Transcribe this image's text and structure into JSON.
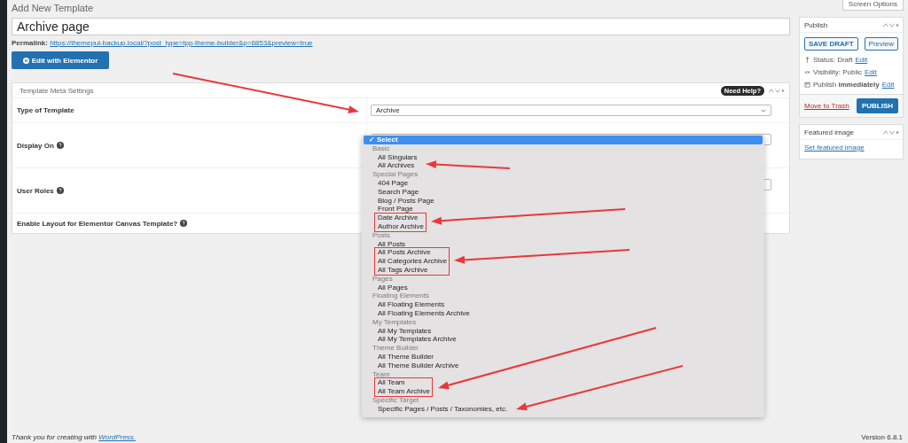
{
  "page": {
    "title": "Add New Template",
    "screen_options": "Screen Options"
  },
  "post_title": {
    "value": "Archive page"
  },
  "permalink": {
    "label": "Permalink:",
    "url": "https://themepul-backup.local/?post_type=tpp-theme-builder&p=6853&preview=true"
  },
  "elementor_button": "Edit with Elementor",
  "meta_box": {
    "title": "Template Meta Settings",
    "help_badge": "Need Help?",
    "fields": [
      {
        "label": "Type of Template",
        "help": false,
        "kind": "select",
        "value": "Archive"
      },
      {
        "label": "Display On",
        "help": true,
        "kind": "rule"
      },
      {
        "label": "User Roles",
        "help": true,
        "kind": "rule"
      },
      {
        "label": "Enable Layout for Elementor Canvas Template?",
        "help": true,
        "kind": "plain"
      }
    ]
  },
  "dropdown": {
    "first_option": {
      "label": "Select",
      "selected": true,
      "check": "✓"
    },
    "groups": [
      {
        "label": "Basic",
        "options": [
          {
            "label": "All Singulars",
            "selected": false,
            "highlighted": false
          },
          {
            "label": "All Archives",
            "selected": false,
            "highlighted": false
          }
        ]
      },
      {
        "label": "Special Pages",
        "options": [
          {
            "label": "404 Page",
            "selected": false,
            "highlighted": false
          },
          {
            "label": "Search Page",
            "selected": false,
            "highlighted": false
          },
          {
            "label": "Blog / Posts Page",
            "selected": false,
            "highlighted": false
          },
          {
            "label": "Front Page",
            "selected": false,
            "highlighted": false
          },
          {
            "label": "Date Archive",
            "selected": false,
            "highlighted": true
          },
          {
            "label": "Author Archive",
            "selected": false,
            "highlighted": true
          }
        ]
      },
      {
        "label": "Posts",
        "options": [
          {
            "label": "All Posts",
            "selected": false,
            "highlighted": false
          },
          {
            "label": "All Posts Archive",
            "selected": false,
            "highlighted": true
          },
          {
            "label": "All Categories Archive",
            "selected": false,
            "highlighted": true
          },
          {
            "label": "All Tags Archive",
            "selected": false,
            "highlighted": true
          }
        ]
      },
      {
        "label": "Pages",
        "options": [
          {
            "label": "All Pages",
            "selected": false,
            "highlighted": false
          }
        ]
      },
      {
        "label": "Floating Elements",
        "options": [
          {
            "label": "All Floating Elements",
            "selected": false,
            "highlighted": false
          },
          {
            "label": "All Floating Elements Archive",
            "selected": false,
            "highlighted": false
          }
        ]
      },
      {
        "label": "My Templates",
        "options": [
          {
            "label": "All My Templates",
            "selected": false,
            "highlighted": false
          },
          {
            "label": "All My Templates Archive",
            "selected": false,
            "highlighted": false
          }
        ]
      },
      {
        "label": "Theme Builder",
        "options": [
          {
            "label": "All Theme Builder",
            "selected": false,
            "highlighted": false
          },
          {
            "label": "All Theme Builder Archive",
            "selected": false,
            "highlighted": false
          }
        ]
      },
      {
        "label": "Team",
        "options": [
          {
            "label": "All Team",
            "selected": false,
            "highlighted": true
          },
          {
            "label": "All Team Archive",
            "selected": false,
            "highlighted": true
          }
        ]
      },
      {
        "label": "Specific Target",
        "options": [
          {
            "label": "Specific Pages / Posts / Taxonomies, etc.",
            "selected": false,
            "highlighted": false
          }
        ]
      }
    ]
  },
  "publish_box": {
    "title": "Publish",
    "save_draft": "SAVE DRAFT",
    "preview": "Preview",
    "status": "Status: Draft",
    "visibility": "Visibility: Public",
    "schedule": "Publish **immediately**",
    "edit_links": [
      "Edit",
      "Edit",
      "Edit"
    ],
    "trash": "Move to Trash",
    "publish": "PUBLISH"
  },
  "featured_image": {
    "title": "Featured image",
    "link": "Set featured image"
  },
  "footer": {
    "thanks": "Thank you for creating with",
    "link": "WordPress.",
    "version": "Version 6.8.1"
  }
}
